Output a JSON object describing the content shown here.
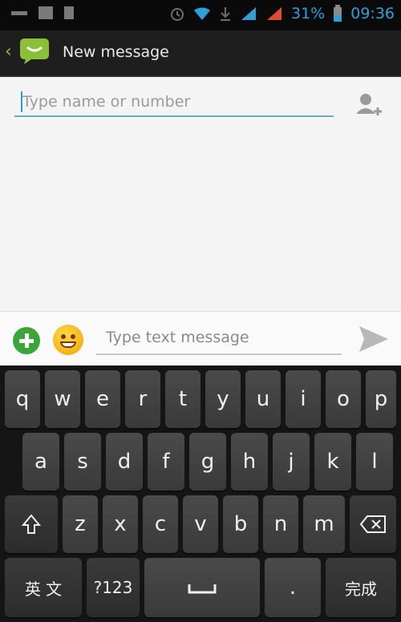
{
  "status_bar": {
    "battery": "31%",
    "time": "09:36",
    "icons": [
      "minus-icon",
      "image-icon",
      "sim-icon",
      "alarm-icon",
      "wifi-icon",
      "download-icon",
      "signal-icon",
      "signal-icon",
      "battery-icon"
    ]
  },
  "action_bar": {
    "title": "New message",
    "app_icon": "messaging-app-icon",
    "back_icon": "chevron-left-icon"
  },
  "recipient": {
    "placeholder": "Type name or number",
    "add_icon": "add-contact-icon"
  },
  "message_bar": {
    "placeholder": "Type text message",
    "attach_icon": "add-attachment-icon",
    "emoji_icon": "emoji-icon",
    "send_icon": "send-icon"
  },
  "keyboard": {
    "row1": [
      "q",
      "w",
      "e",
      "r",
      "t",
      "y",
      "u",
      "i",
      "o",
      "p"
    ],
    "row2": [
      "a",
      "s",
      "d",
      "f",
      "g",
      "h",
      "j",
      "k",
      "l"
    ],
    "row3": [
      "z",
      "x",
      "c",
      "v",
      "b",
      "n",
      "m"
    ],
    "shift_icon": "shift-icon",
    "backspace_icon": "backspace-icon",
    "lang_label": "英 文",
    "symbols_label": "?123",
    "space_icon": "space-icon",
    "period_label": ".",
    "done_label": "完成"
  },
  "colors": {
    "accent": "#2f9fd8",
    "app_green": "#8bbf3a",
    "attach_green": "#3aa63a"
  }
}
